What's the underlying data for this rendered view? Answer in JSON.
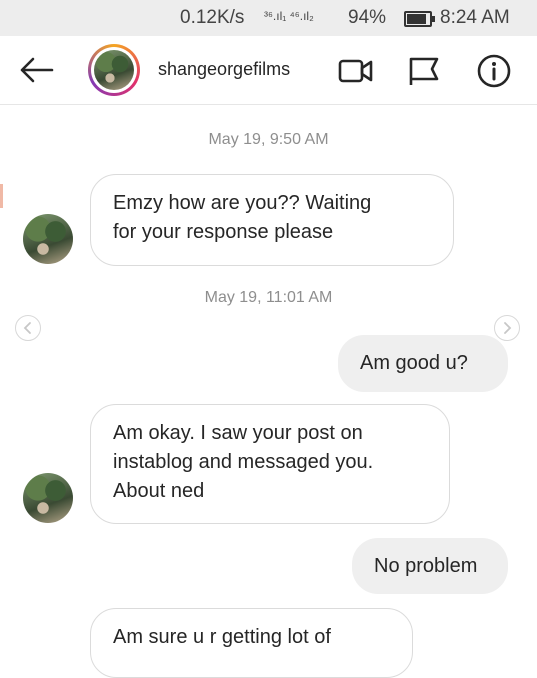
{
  "status_bar": {
    "speed": "0.12K/s",
    "signals": "³⁶.ıl₁ ⁴⁶.ıl₂",
    "battery": "94%",
    "time": "8:24 AM"
  },
  "header": {
    "username": "shangeorgefilms",
    "icons": [
      "back-arrow-icon",
      "video-call-icon",
      "flag-icon",
      "info-icon"
    ]
  },
  "conversation": {
    "timestamps": [
      "May 19, 9:50 AM",
      "May 19, 11:01 AM"
    ],
    "messages": [
      {
        "from": "them",
        "text": "Emzy how are you??  Waiting\nfor your response please"
      },
      {
        "from": "me",
        "text": "Am good u?"
      },
      {
        "from": "them",
        "text": "Am okay. I saw your post on\ninstablog and messaged you.\nAbout ned"
      },
      {
        "from": "me",
        "text": "No problem"
      },
      {
        "from": "them",
        "text": "Am sure u r getting lot of"
      }
    ]
  },
  "colors": {
    "status_bar_bg": "#ededed",
    "incoming_bubble_border": "#dbdbdb",
    "outgoing_bubble_bg": "#efefef",
    "timestamp_text": "#8e8e8e",
    "story_ring": [
      "#f5a623",
      "#e1306c",
      "#833ab4"
    ]
  }
}
